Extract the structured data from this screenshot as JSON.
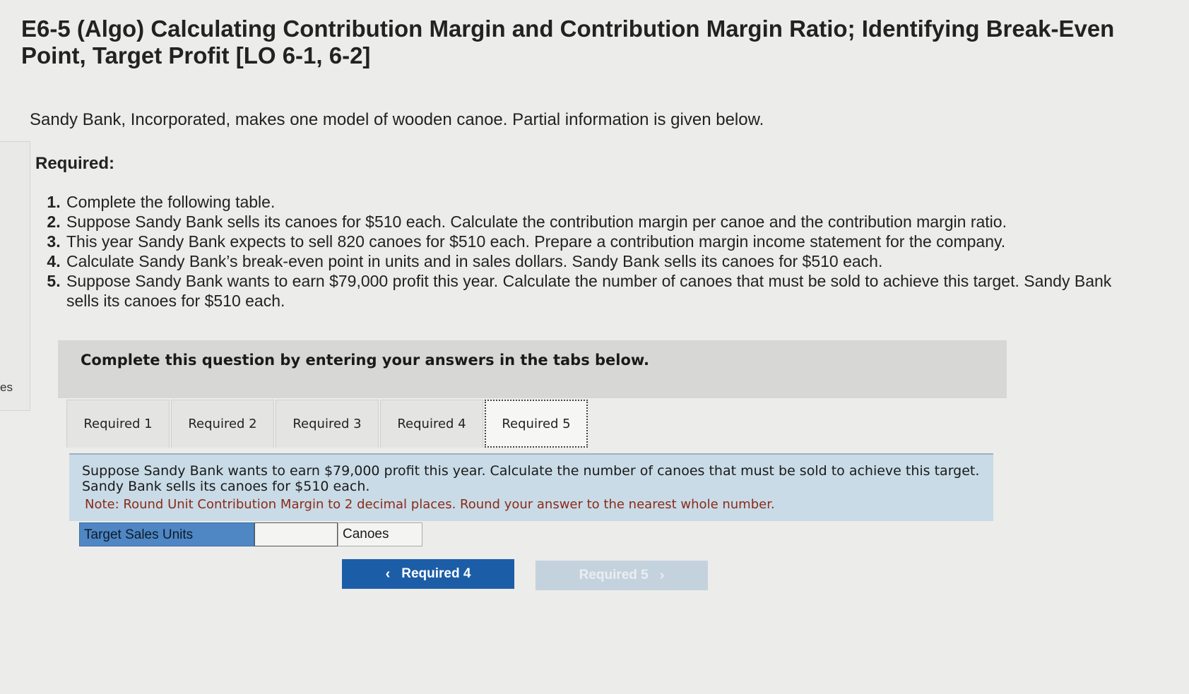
{
  "header": {
    "title": "E6-5 (Algo) Calculating Contribution Margin and Contribution Margin Ratio; Identifying Break-Even Point, Target Profit [LO 6-1, 6-2]"
  },
  "sidebar_fragment": "es",
  "intro": "Sandy Bank, Incorporated, makes one model of wooden canoe. Partial information is given below.",
  "required_heading": "Required:",
  "requirements": [
    "Complete the following table.",
    "Suppose Sandy Bank sells its canoes for $510 each. Calculate the contribution margin per canoe and the contribution margin ratio.",
    "This year Sandy Bank expects to sell 820 canoes for $510 each. Prepare a contribution margin income statement for the company.",
    "Calculate Sandy Bank’s break-even point in units and in sales dollars. Sandy Bank sells its canoes for $510 each.",
    "Suppose Sandy Bank wants to earn $79,000 profit this year. Calculate the number of canoes that must be sold to achieve this target. Sandy Bank sells its canoes for $510 each."
  ],
  "instructions": "Complete this question by entering your answers in the tabs below.",
  "tabs": [
    {
      "label": "Required 1",
      "active": false
    },
    {
      "label": "Required 2",
      "active": false
    },
    {
      "label": "Required 3",
      "active": false
    },
    {
      "label": "Required 4",
      "active": false
    },
    {
      "label": "Required 5",
      "active": true
    }
  ],
  "panel": {
    "question": "Suppose Sandy Bank wants to earn $79,000 profit this year. Calculate the number of canoes that must be sold to achieve this target. Sandy Bank sells its canoes for $510 each.",
    "note": "Note: Round Unit Contribution Margin to 2 decimal places. Round your answer to the nearest whole number."
  },
  "answer": {
    "label": "Target Sales Units",
    "value": "",
    "unit": "Canoes"
  },
  "nav": {
    "prev_label": "Required 4",
    "next_label": "Required 5",
    "prev_icon": "chevron-left-icon",
    "next_icon": "chevron-right-icon"
  },
  "colors": {
    "accent": "#1c5da8",
    "panel": "#c9dbe6",
    "label_cell": "#4f86c4",
    "note": "#8a2a1a"
  }
}
